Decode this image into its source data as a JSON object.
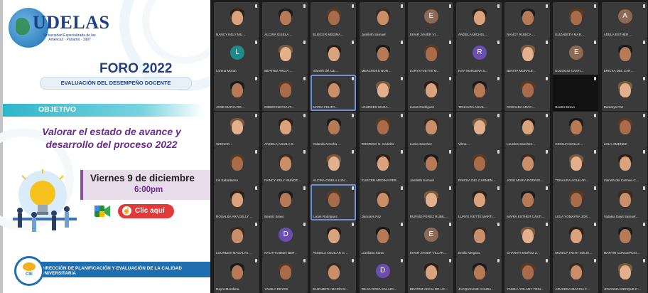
{
  "flyer": {
    "logo_text": "UDELAS",
    "logo_sub": "Universidad Especializada de las Américas · Panamá · 1997",
    "foro_title": "FORO 2022",
    "eval_band": "EVALUACIÓN DEL DESEMPEÑO DOCENTE",
    "objetivo_label": "OBJETIVO",
    "objective_text": "Valorar el estado de avance y desarrollo del proceso 2022",
    "date_text": "Viernes 9 de diciembre",
    "time_text": "6:00pm",
    "click_label": "Clic aquí",
    "bottom_band": "DIRECCIÓN DE PLANIFICACIÓN Y EVALUACIÓN DE LA CALIDAD UNIVERSITARIA",
    "badge_label": "CIE",
    "colors": {
      "title": "#23417f",
      "accent": "#6a2b8e",
      "teal": "#2eb6c9",
      "button": "#e23a3a"
    }
  },
  "grid": {
    "rows": [
      [
        "NANCY KELY MU…",
        "ALCIRA GISELA …",
        "ELIECER MEDINA…",
        "Jamileth Samuel",
        "EIVAR JAVIER VI…",
        "ANGELA MICHEL…",
        "NANCY RUBICA …",
        "ELIZABETH MAR…",
        "ADELA ESTHER …"
      ],
      [
        "Lorena Moran",
        "BEATRIZ ARCIA …",
        "Vianeth del Car…",
        "MERCEDES NOR…",
        "LURYS IVETTE M…",
        "RITA MARLENA S…",
        "BENITA MORALE…",
        "EULOGIO CASTI…",
        "ERICKA DEL CAR…"
      ],
      [
        "JOSE MARIA RO…",
        "DIDIER NEYSALT…",
        "MARIA FELIPA…",
        "LOURDES MAGA…",
        "Lucas Rodriguez",
        "TENAURA AGUIL…",
        "ROSALBA ARAC…",
        "Beatriz Bravo",
        "Damarys Paz"
      ],
      [
        "WIONAR…",
        "ANGELA AGUILA S.",
        "Yolanda Arrocha …",
        "RODRIGO G. Cedeño",
        "Lucila Sanchez",
        "Vilma …",
        "Lourdes Sanchez…",
        "CECILIA MOLLE…",
        "LOLA JIMENEZ"
      ],
      [
        "Iris Sabarlaena",
        "NANCY KELY MUÑOZ…",
        "ALCIRA GISELA LUN…",
        "ELIECER MEDINA PER…",
        "Jamileth Samuel",
        "ERICKA DEL CARMEN…",
        "JOSE MARIA RODRIG…",
        "TENAURA AGUILAR…",
        "Vianeth del Carmen C…"
      ],
      [
        "ROSALBA ARACELLY …",
        "Beatriz Bravo",
        "Lucas Rodriguez",
        "Damarys Paz",
        "RUFINO PEREZ RUBIL…",
        "LURYS IVETTE MARTI…",
        "MARÍA ESTHER CASTI…",
        "LIGIA YOMAYRA JOR…",
        "Yadaisa Dayit Samuel…"
      ],
      [
        "LOURDES MAGALYS …",
        "RAUTH DIMDA BER…",
        "ANGELA AGUILAR G…",
        "Luzdiana Santo",
        "EIVAR JAVIER VILLAR…",
        "Emilio Vergara",
        "CHARITH MUÑOZ Z…",
        "MONICA IVETH SOLIS…",
        "MARTIN CONCEPCIO…"
      ],
      [
        "Dayra Mendieta",
        "YAMILA REYES",
        "ELIZABETH MARÍA M…",
        "DILSA ROSA SALAZA…",
        "BEATRIZ ARCIA DE LO…",
        "JACQUELINE CANDA…",
        "YAMILA YOLANY TRIN…",
        "AZUCENA MACCIA F…",
        "JOVANNA ENRIQUE C…"
      ]
    ],
    "avatars": {
      "0,4": {
        "letter": "E",
        "color": "#8c6a56"
      },
      "0,8": {
        "letter": "A",
        "color": "#8c6a56"
      },
      "1,0": {
        "letter": "L",
        "color": "#1f8a8a"
      },
      "1,5": {
        "letter": "R",
        "color": "#6b4fb0"
      },
      "1,7": {
        "letter": "E",
        "color": "#8c6a56"
      },
      "6,1": {
        "letter": "D",
        "color": "#6b4fb0"
      },
      "6,4": {
        "letter": "E",
        "color": "#8c6a56"
      },
      "7,3": {
        "letter": "D",
        "color": "#6b4fb0"
      }
    },
    "highlight_tiles": [
      "2,2",
      "5,2"
    ],
    "dark_tiles": [
      "2,7"
    ]
  }
}
